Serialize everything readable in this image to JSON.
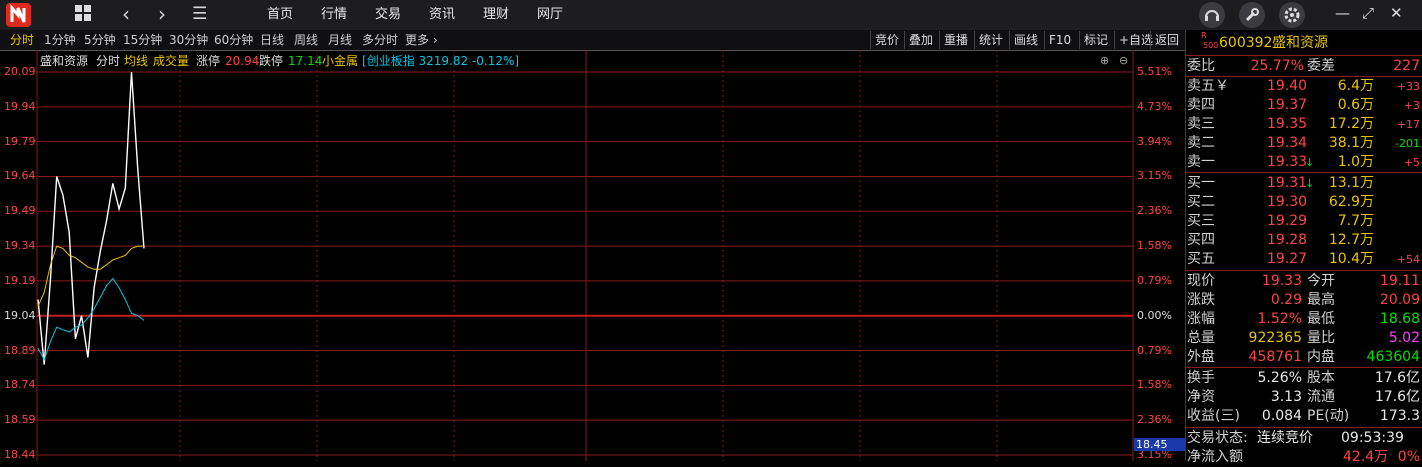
{
  "topbar": {
    "nav": [
      "首页",
      "行情",
      "交易",
      "资讯",
      "理财",
      "网厅"
    ]
  },
  "periods": [
    "分时",
    "1分钟",
    "5分钟",
    "15分钟",
    "30分钟",
    "60分钟",
    "日线",
    "周线",
    "月线",
    "多分时",
    "更多"
  ],
  "active_period": "分时",
  "right_buttons": [
    "竞价",
    "叠加",
    "重播",
    "统计",
    "画线",
    "F10",
    "标记",
    "+自选",
    "返回"
  ],
  "header": {
    "name": "盛和资源",
    "mode": "分时",
    "avg_line": "均线",
    "volume": "成交量",
    "limit_up_label": "涨停",
    "limit_up": "20.94",
    "limit_down_label": "跌停",
    "limit_down": "17.14",
    "sector": "小金属",
    "index": "创业板指 3219.82 -0.12%]"
  },
  "chart_data": {
    "type": "line",
    "y_ticks": [
      "20.09",
      "19.94",
      "19.79",
      "19.64",
      "19.49",
      "19.34",
      "19.19",
      "19.04",
      "18.89",
      "18.74",
      "18.59",
      "18.44"
    ],
    "pct_ticks": [
      "5.51%",
      "4.73%",
      "3.94%",
      "3.15%",
      "2.36%",
      "1.58%",
      "0.79%",
      "0.00%",
      "0.79%",
      "1.58%",
      "2.36%",
      "3.15%"
    ],
    "ylim": [
      18.44,
      20.09
    ],
    "prev_close": 19.04,
    "cursor_price": "18.45",
    "series": [
      {
        "name": "price",
        "values": [
          19.11,
          18.83,
          19.2,
          19.64,
          19.56,
          19.4,
          18.94,
          19.04,
          18.86,
          19.16,
          19.32,
          19.45,
          19.61,
          19.5,
          19.59,
          20.09,
          19.67,
          19.33
        ]
      },
      {
        "name": "均线",
        "values": [
          19.08,
          19.14,
          19.26,
          19.34,
          19.33,
          19.3,
          19.29,
          19.27,
          19.25,
          19.24,
          19.24,
          19.26,
          19.28,
          19.29,
          19.3,
          19.33,
          19.34,
          19.34
        ]
      },
      {
        "name": "创业板指",
        "values": [
          18.9,
          18.85,
          18.93,
          18.99,
          18.98,
          18.97,
          18.99,
          19.0,
          19.03,
          19.07,
          19.12,
          19.17,
          19.2,
          19.16,
          19.11,
          19.05,
          19.04,
          19.02
        ]
      }
    ]
  },
  "quote": {
    "code": "600392",
    "name": "盛和资源",
    "badge_top": "R",
    "badge_bottom": "500",
    "weibi_label": "委比",
    "weibi": "25.77%",
    "weicha_label": "委差",
    "weicha": "227",
    "sells": [
      {
        "label": "卖五￥",
        "price": "19.40",
        "vol": "6.4万",
        "chg": "+33",
        "arrow": ""
      },
      {
        "label": "卖四",
        "price": "19.37",
        "vol": "0.6万",
        "chg": "+3",
        "arrow": ""
      },
      {
        "label": "卖三",
        "price": "19.35",
        "vol": "17.2万",
        "chg": "+17",
        "arrow": ""
      },
      {
        "label": "卖二",
        "price": "19.34",
        "vol": "38.1万",
        "chg": "-201",
        "arrow": ""
      },
      {
        "label": "卖一",
        "price": "19.33",
        "vol": "1.0万",
        "chg": "+5",
        "arrow": "↓"
      }
    ],
    "buys": [
      {
        "label": "买一",
        "price": "19.31",
        "vol": "13.1万",
        "chg": "",
        "arrow": "↓"
      },
      {
        "label": "买二",
        "price": "19.30",
        "vol": "62.9万",
        "chg": "",
        "arrow": ""
      },
      {
        "label": "买三",
        "price": "19.29",
        "vol": "7.7万",
        "chg": "",
        "arrow": ""
      },
      {
        "label": "买四",
        "price": "19.28",
        "vol": "12.7万",
        "chg": "",
        "arrow": ""
      },
      {
        "label": "买五",
        "price": "19.27",
        "vol": "10.4万",
        "chg": "+54",
        "arrow": ""
      }
    ],
    "stats": [
      {
        "l1": "现价",
        "v1": "19.33",
        "c1": "red",
        "l2": "今开",
        "v2": "19.11",
        "c2": "red"
      },
      {
        "l1": "涨跌",
        "v1": "0.29",
        "c1": "red",
        "l2": "最高",
        "v2": "20.09",
        "c2": "red"
      },
      {
        "l1": "涨幅",
        "v1": "1.52%",
        "c1": "red",
        "l2": "最低",
        "v2": "18.68",
        "c2": "green"
      },
      {
        "l1": "总量",
        "v1": "922365",
        "c1": "yellow",
        "l2": "量比",
        "v2": "5.02",
        "c2": "magenta"
      },
      {
        "l1": "外盘",
        "v1": "458761",
        "c1": "red",
        "l2": "内盘",
        "v2": "463604",
        "c2": "green"
      }
    ],
    "stats2": [
      {
        "l1": "换手",
        "v1": "5.26%",
        "l2": "股本",
        "v2": "17.6亿"
      },
      {
        "l1": "净资",
        "v1": "3.13",
        "l2": "流通",
        "v2": "17.6亿"
      },
      {
        "l1": "收益(三)",
        "v1": "0.084",
        "l2": "PE(动)",
        "v2": "173.3"
      }
    ],
    "trade_status_label": "交易状态:",
    "trade_status": "连续竞价",
    "time": "09:53:39",
    "net_inflow_label": "净流入额",
    "net_inflow": "42.4万",
    "net_inflow_pct": "0%"
  },
  "colors": {
    "up": "#ff4444",
    "down": "#00e000",
    "avg": "#e8c400",
    "price": "#ffffff",
    "index": "#00c8e8",
    "grid": "#8a1a1a"
  }
}
